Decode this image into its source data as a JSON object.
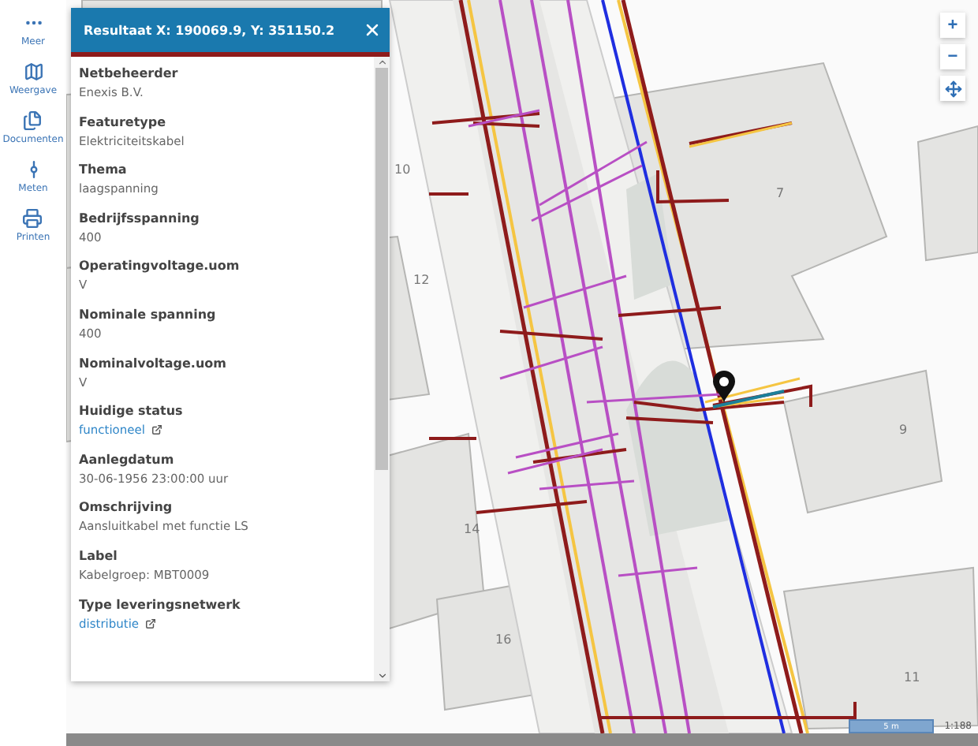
{
  "nav": [
    {
      "label": "Meer",
      "kind": "more"
    },
    {
      "label": "Weergave",
      "kind": "view"
    },
    {
      "label": "Documenten",
      "kind": "documents"
    },
    {
      "label": "Meten",
      "kind": "measure"
    },
    {
      "label": "Printen",
      "kind": "print"
    }
  ],
  "panel": {
    "title": "Resultaat X: 190069.9, Y: 351150.2",
    "fields": [
      {
        "label": "Netbeheerder",
        "value": "Enexis B.V.",
        "link": false
      },
      {
        "label": "Featuretype",
        "value": "Elektriciteitskabel",
        "link": false
      },
      {
        "label": "Thema",
        "value": "laagspanning",
        "link": false
      },
      {
        "label": "Bedrijfsspanning",
        "value": "400",
        "link": false
      },
      {
        "label": "Operatingvoltage.uom",
        "value": "V",
        "link": false
      },
      {
        "label": "Nominale spanning",
        "value": "400",
        "link": false
      },
      {
        "label": "Nominalvoltage.uom",
        "value": "V",
        "link": false
      },
      {
        "label": "Huidige status",
        "value": "functioneel",
        "link": true
      },
      {
        "label": "Aanlegdatum",
        "value": "30-06-1956 23:00:00 uur",
        "link": false
      },
      {
        "label": "Omschrijving",
        "value": "Aansluitkabel met functie LS",
        "link": false
      },
      {
        "label": "Label",
        "value": "Kabelgroep: MBT0009",
        "link": false
      },
      {
        "label": "Type leveringsnetwerk",
        "value": "distributie",
        "link": true
      }
    ]
  },
  "map": {
    "building_numbers": [
      "10",
      "12",
      "7",
      "9",
      "14",
      "16",
      "11"
    ],
    "zoom_controls": [
      {
        "label": "+",
        "kind": "zoom-in"
      },
      {
        "label": "−",
        "kind": "zoom-out"
      },
      {
        "kind": "pan"
      }
    ],
    "scale_bar": "5 m",
    "scale_ratio": "1:188"
  }
}
